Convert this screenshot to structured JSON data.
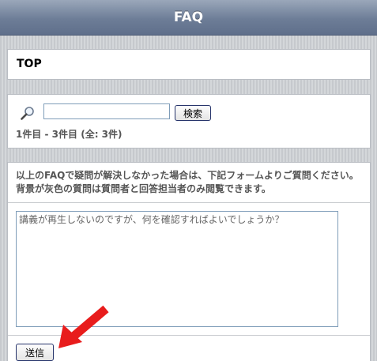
{
  "header": {
    "title": "FAQ"
  },
  "top_panel": {
    "title": "TOP"
  },
  "search": {
    "input_value": "",
    "button_label": "検索",
    "result_count": "1件目 - 3件目 (全: 3件)"
  },
  "question_form": {
    "notice": "以上のFAQで疑問が解決しなかった場合は、下記フォームよりご質問ください。背景が灰色の質問は質問者と回答担当者のみ閲覧できます。",
    "textarea_value": "講義が再生しないのですが、何を確認すればよいでしょうか？",
    "submit_label": "送信"
  },
  "annotation": {
    "arrow_color": "#e81c1c",
    "arrow_icon": "red-arrow-icon"
  }
}
